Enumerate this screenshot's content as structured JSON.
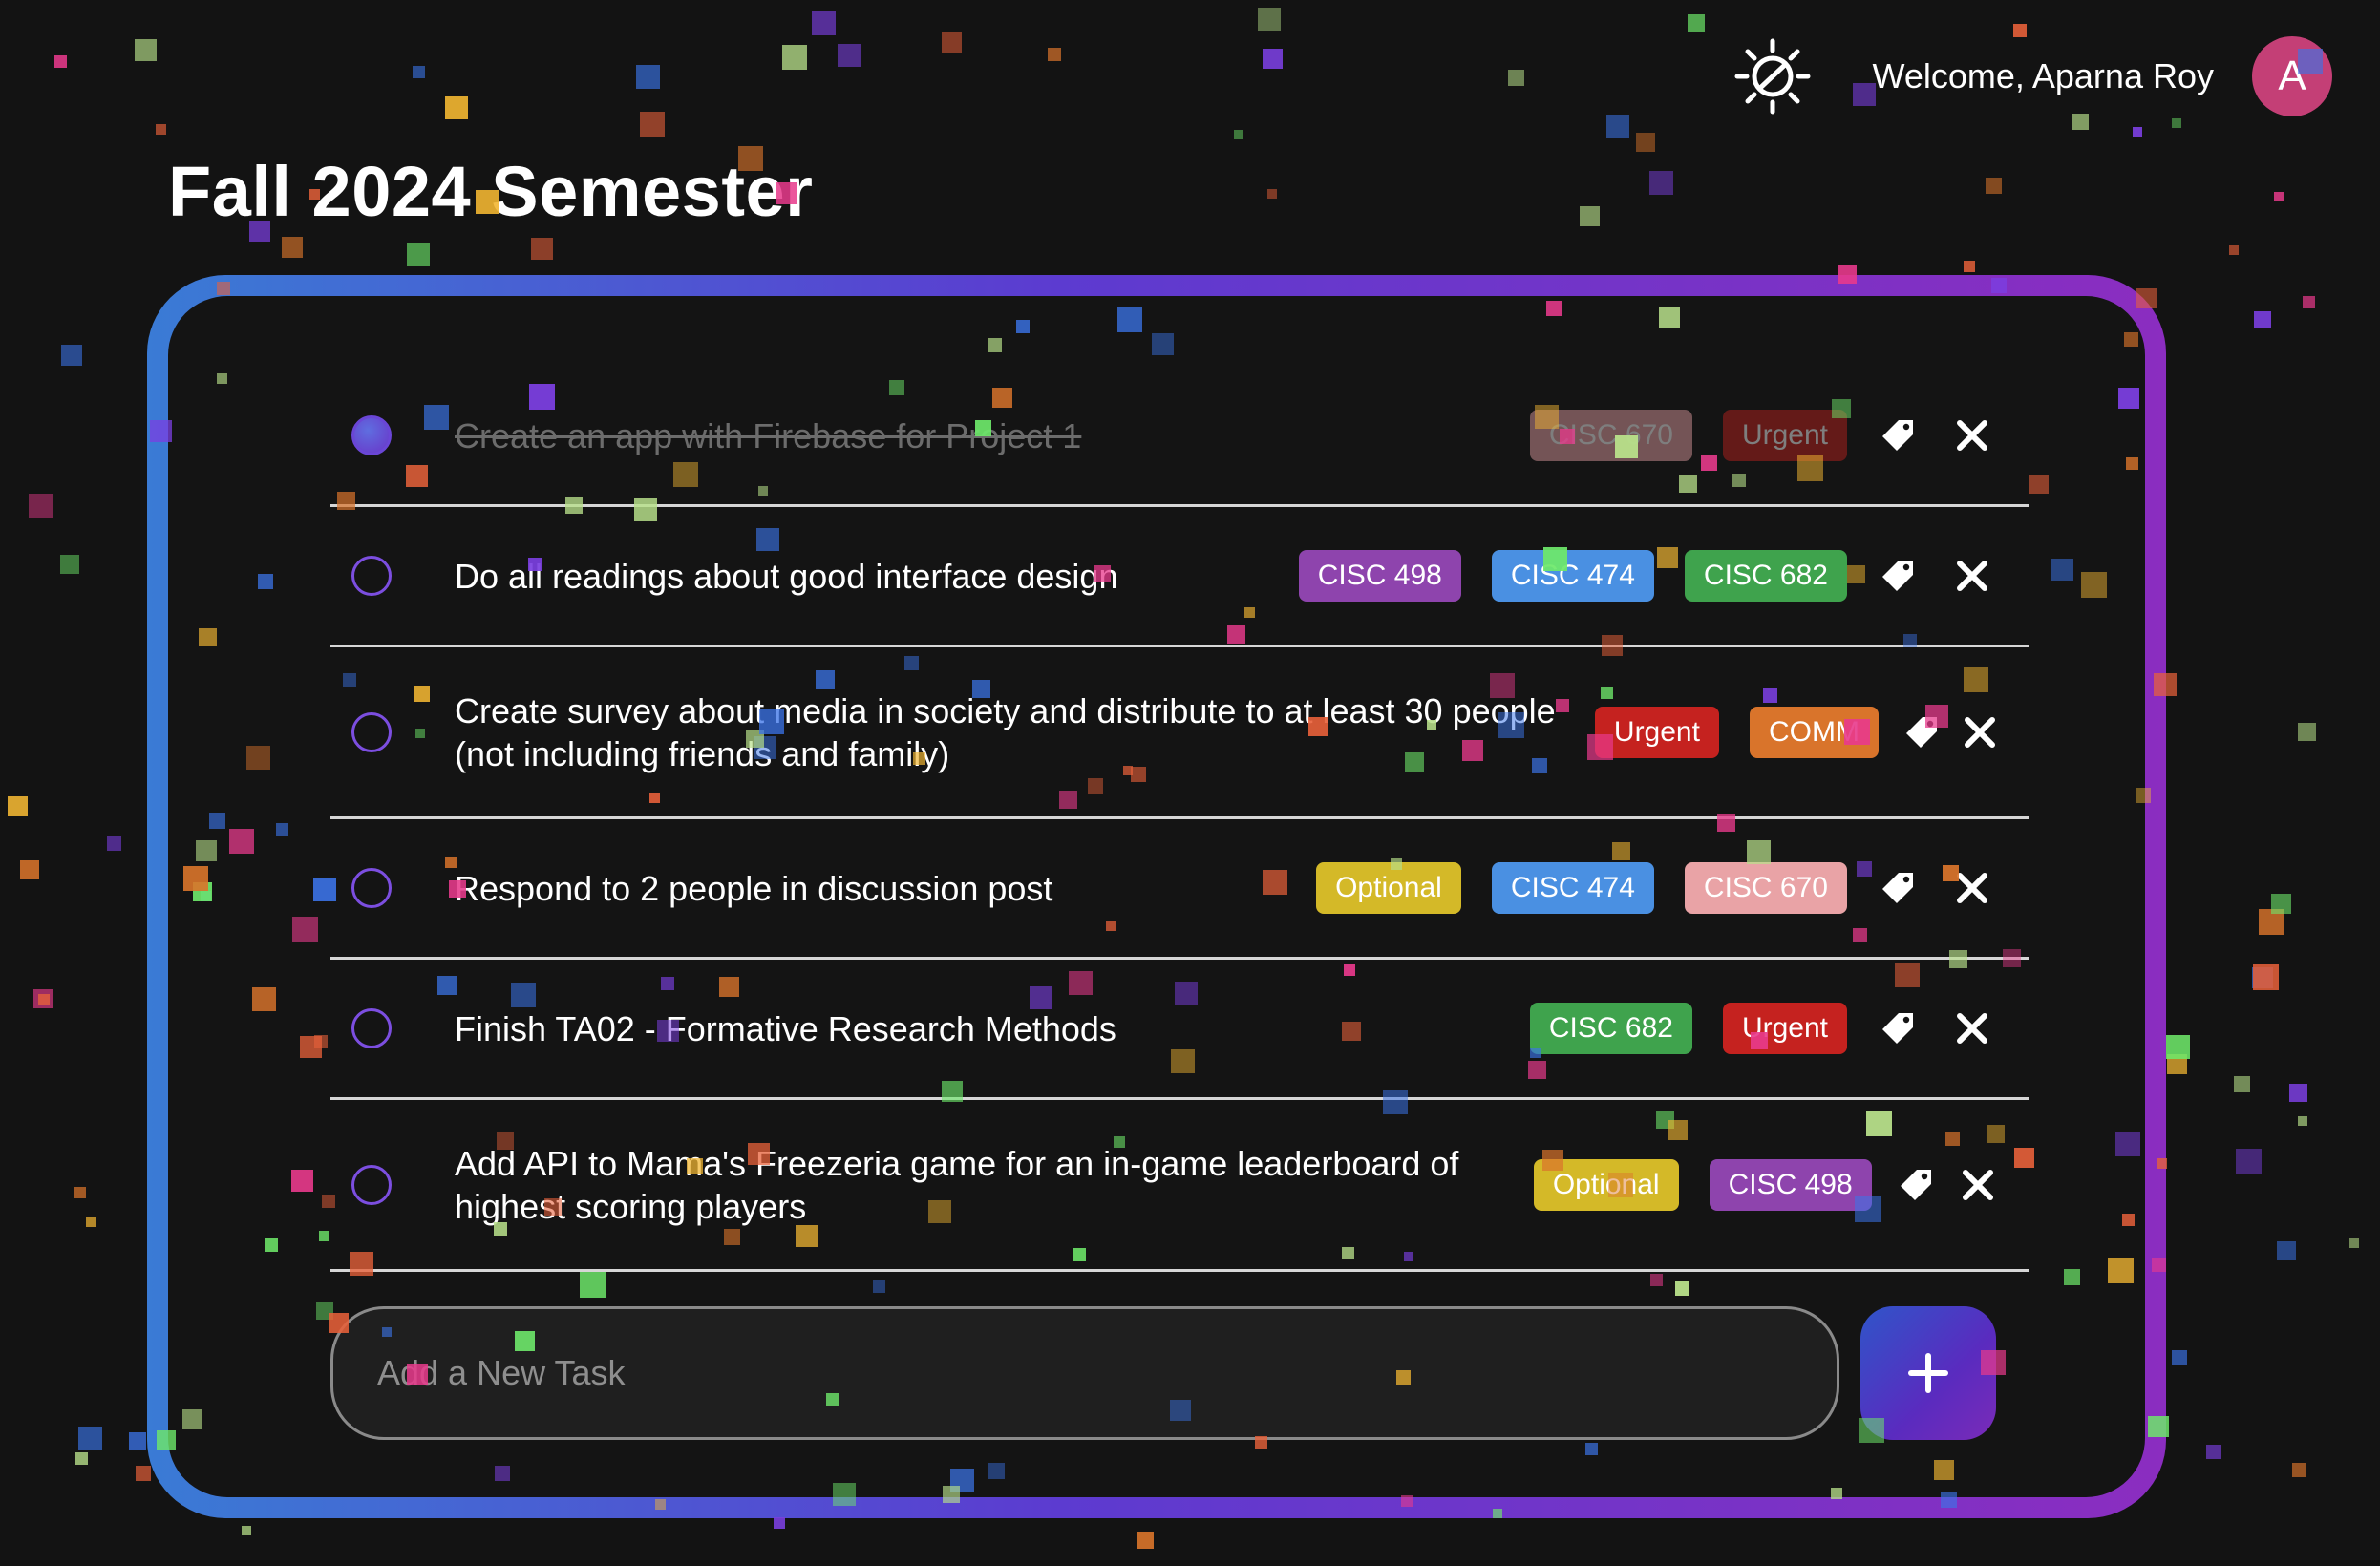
{
  "header": {
    "welcome_text": "Welcome, Aparna Roy",
    "avatar_initial": "A",
    "theme_icon": "theme-toggle-icon"
  },
  "page": {
    "title": "Fall 2024 Semester"
  },
  "tag_colors": {
    "CISC 670": "#e9a3a6",
    "CISC 498": "#8e44ad",
    "CISC 474": "#4a90e2",
    "CISC 682": "#3fa34d",
    "Urgent": "#c5221f",
    "COMM": "#d9742b",
    "Optional": "#d4b928"
  },
  "tasks": [
    {
      "text": "Create an app with Firebase for Project 1",
      "done": true,
      "tags": [
        "CISC 670",
        "Urgent"
      ]
    },
    {
      "text": "Do all readings about good interface design",
      "done": false,
      "tags": [
        "CISC 498",
        "CISC 474",
        "CISC 682"
      ]
    },
    {
      "text": "Create survey about media in society and distribute to at least 30 people (not including friends and family)",
      "done": false,
      "tags": [
        "Urgent",
        "COMM"
      ]
    },
    {
      "text": "Respond to 2 people in discussion post",
      "done": false,
      "tags": [
        "Optional",
        "CISC 474",
        "CISC 670"
      ]
    },
    {
      "text": "Finish TA02 - Formative Research Methods",
      "done": false,
      "tags": [
        "CISC 682",
        "Urgent"
      ]
    },
    {
      "text": "Add API to Mama's Freezeria game for an in-game leaderboard of highest scoring players",
      "done": false,
      "tags": [
        "Optional",
        "CISC 498"
      ]
    }
  ],
  "new_task": {
    "placeholder": "Add a New Task",
    "value": ""
  },
  "add_button": {
    "icon": "plus-icon"
  },
  "icons": {
    "tag": "tag-icon",
    "delete": "close-icon"
  },
  "confetti_colors": [
    "#e8613a",
    "#f2b632",
    "#6ee86a",
    "#3b74e8",
    "#7b3fe0",
    "#e83a8c",
    "#b8e08a",
    "#d9742b"
  ]
}
